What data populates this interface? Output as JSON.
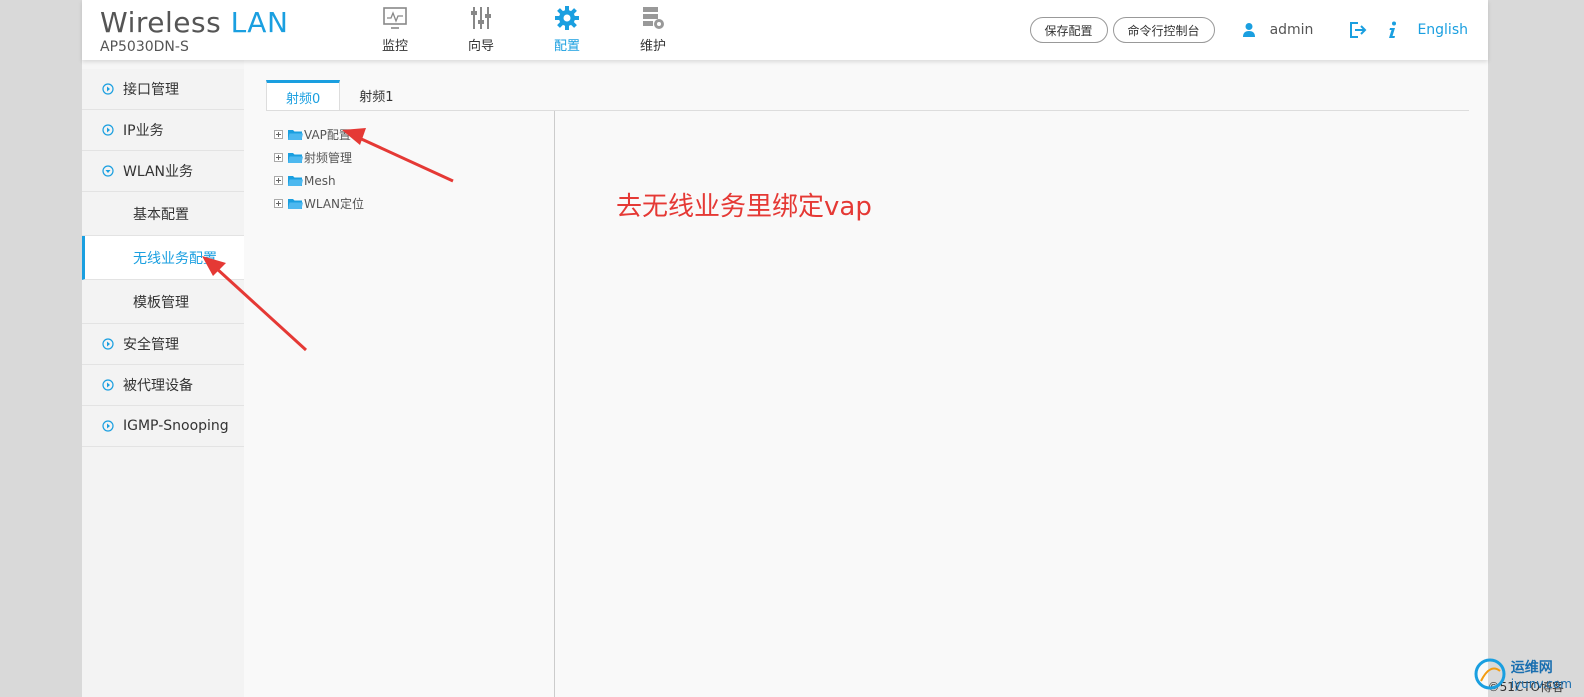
{
  "brand": {
    "title_part1": "Wireless",
    "title_part2": "LAN",
    "model": "AP5030DN-S"
  },
  "topnav": [
    {
      "label": "监控",
      "icon": "monitor-icon"
    },
    {
      "label": "向导",
      "icon": "sliders-icon"
    },
    {
      "label": "配置",
      "icon": "gear-icon",
      "active": true
    },
    {
      "label": "维护",
      "icon": "server-gear-icon"
    }
  ],
  "header": {
    "save_label": "保存配置",
    "console_label": "命令行控制台",
    "user": "admin",
    "language": "English"
  },
  "sidebar": {
    "items": [
      {
        "label": "接口管理"
      },
      {
        "label": "IP业务"
      },
      {
        "label": "WLAN业务",
        "expanded": true
      },
      {
        "label": "安全管理"
      },
      {
        "label": "被代理设备"
      },
      {
        "label": "IGMP-Snooping"
      }
    ],
    "subitems": [
      {
        "label": "基本配置"
      },
      {
        "label": "无线业务配置",
        "active": true
      },
      {
        "label": "模板管理"
      }
    ]
  },
  "tabs": [
    {
      "label": "射频0",
      "active": true
    },
    {
      "label": "射频1"
    }
  ],
  "tree": [
    {
      "label": "VAP配置"
    },
    {
      "label": "射频管理"
    },
    {
      "label": "Mesh"
    },
    {
      "label": "WLAN定位"
    }
  ],
  "annotation": "去无线业务里绑定vap",
  "watermark": {
    "brand": "运维网",
    "sub": "iyunv.com",
    "site": "©51CTO博客"
  },
  "colors": {
    "accent": "#1a9fe0",
    "annotation": "#e53935"
  }
}
